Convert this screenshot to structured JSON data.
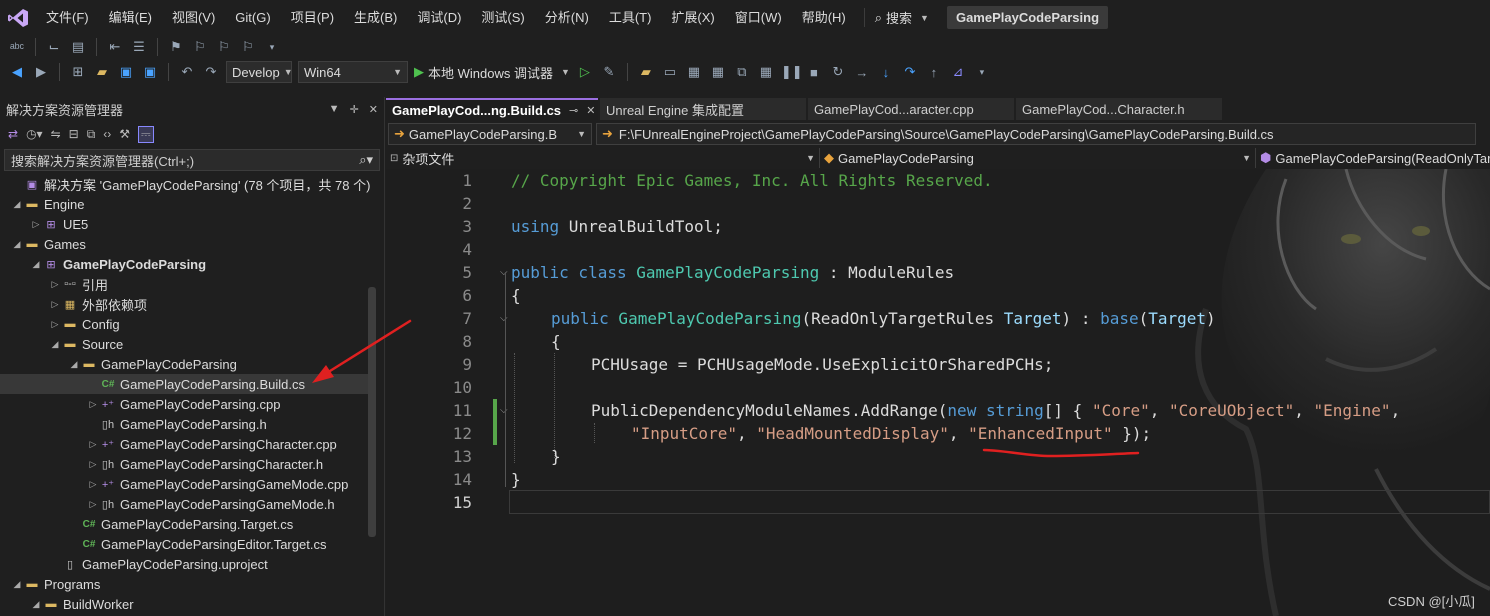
{
  "menu": {
    "items": [
      "文件(F)",
      "编辑(E)",
      "视图(V)",
      "Git(G)",
      "项目(P)",
      "生成(B)",
      "调试(D)",
      "测试(S)",
      "分析(N)",
      "工具(T)",
      "扩展(X)",
      "窗口(W)",
      "帮助(H)"
    ],
    "search_label": "搜索",
    "project_title": "GamePlayCodeParsing"
  },
  "toolbar": {
    "config_value": "Develop",
    "platform_value": "Win64",
    "debugger_label": "本地 Windows 调试器"
  },
  "solution_explorer": {
    "title": "解决方案资源管理器",
    "search_placeholder": "搜索解决方案资源管理器(Ctrl+;)",
    "tree": [
      {
        "label": "解决方案 'GamePlayCodeParsing' (78 个项目，共 78 个)",
        "icon": "solution-icon",
        "depth": 0,
        "expander": ""
      },
      {
        "label": "Engine",
        "icon": "folder-icon",
        "depth": 0,
        "expander": "open"
      },
      {
        "label": "UE5",
        "icon": "project-icon",
        "depth": 1,
        "expander": "closed"
      },
      {
        "label": "Games",
        "icon": "folder-icon",
        "depth": 0,
        "expander": "open"
      },
      {
        "label": "GamePlayCodeParsing",
        "icon": "project-icon",
        "depth": 1,
        "expander": "open",
        "bold": true
      },
      {
        "label": "引用",
        "icon": "references-icon",
        "depth": 2,
        "expander": "closed"
      },
      {
        "label": "外部依赖项",
        "icon": "external-deps-icon",
        "depth": 2,
        "expander": "closed"
      },
      {
        "label": "Config",
        "icon": "folder-icon",
        "depth": 2,
        "expander": "closed"
      },
      {
        "label": "Source",
        "icon": "folder-icon",
        "depth": 2,
        "expander": "open"
      },
      {
        "label": "GamePlayCodeParsing",
        "icon": "folder-icon",
        "depth": 3,
        "expander": "open"
      },
      {
        "label": "GamePlayCodeParsing.Build.cs",
        "icon": "csharp-file-icon",
        "depth": 4,
        "expander": "",
        "selected": true
      },
      {
        "label": "GamePlayCodeParsing.cpp",
        "icon": "cpp-file-icon",
        "depth": 4,
        "expander": "closed"
      },
      {
        "label": "GamePlayCodeParsing.h",
        "icon": "header-file-icon",
        "depth": 4,
        "expander": ""
      },
      {
        "label": "GamePlayCodeParsingCharacter.cpp",
        "icon": "cpp-file-icon",
        "depth": 4,
        "expander": "closed"
      },
      {
        "label": "GamePlayCodeParsingCharacter.h",
        "icon": "header-file-icon",
        "depth": 4,
        "expander": "closed"
      },
      {
        "label": "GamePlayCodeParsingGameMode.cpp",
        "icon": "cpp-file-icon",
        "depth": 4,
        "expander": "closed"
      },
      {
        "label": "GamePlayCodeParsingGameMode.h",
        "icon": "header-file-icon",
        "depth": 4,
        "expander": "closed"
      },
      {
        "label": "GamePlayCodeParsing.Target.cs",
        "icon": "csharp-file-icon",
        "depth": 3,
        "expander": ""
      },
      {
        "label": "GamePlayCodeParsingEditor.Target.cs",
        "icon": "csharp-file-icon",
        "depth": 3,
        "expander": ""
      },
      {
        "label": "GamePlayCodeParsing.uproject",
        "icon": "file-icon",
        "depth": 2,
        "expander": ""
      },
      {
        "label": "Programs",
        "icon": "folder-icon",
        "depth": 0,
        "expander": "open"
      },
      {
        "label": "BuildWorker",
        "icon": "folder-icon",
        "depth": 1,
        "expander": "open"
      }
    ]
  },
  "tabs": [
    {
      "label": "GamePlayCod...ng.Build.cs",
      "active": true
    },
    {
      "label": "Unreal Engine 集成配置",
      "active": false
    },
    {
      "label": "GamePlayCod...aracter.cpp",
      "active": false
    },
    {
      "label": "GamePlayCod...Character.h",
      "active": false
    }
  ],
  "pathbar": {
    "file_combo": "GamePlayCodeParsing.B",
    "full_path": "F:\\FUnrealEngineProject\\GamePlayCodeParsing\\Source\\GamePlayCodeParsing\\GamePlayCodeParsing.Build.cs"
  },
  "navbar": {
    "scope": "杂项文件",
    "type": "GamePlayCodeParsing",
    "member": "GamePlayCodeParsing(ReadOnlyTarg"
  },
  "editor": {
    "line_numbers": [
      "1",
      "2",
      "3",
      "4",
      "5",
      "6",
      "7",
      "8",
      "9",
      "10",
      "11",
      "12",
      "13",
      "14",
      "15"
    ],
    "code": {
      "l1": "// Copyright Epic Games, Inc. All Rights Reserved.",
      "l3_kw": "using",
      "l3_rest": " UnrealBuildTool;",
      "l5_kw1": "public",
      "l5_kw2": " class ",
      "l5_ty": "GamePlayCodeParsing",
      "l5_rest1": " : ",
      "l5_rest2": "ModuleRules",
      "l6": "{",
      "l7_kw": "public",
      "l7_fn": " GamePlayCodeParsing",
      "l7_p1": "(ReadOnlyTargetRules ",
      "l7_id": "Target",
      "l7_p2": ") : ",
      "l7_base": "base",
      "l7_p3": "(",
      "l7_id2": "Target",
      "l7_p4": ")",
      "l8": "{",
      "l9": "PCHUsage = PCHUsageMode.UseExplicitOrSharedPCHs;",
      "l11_a": "PublicDependencyModuleNames.AddRange(",
      "l11_new": "new",
      "l11_string": " string",
      "l11_b": "[] { ",
      "l11_s1": "\"Core\"",
      "l11_c1": ", ",
      "l11_s2": "\"CoreUObject\"",
      "l11_c2": ", ",
      "l11_s3": "\"Engine\"",
      "l11_c3": ",",
      "l12_s1": "\"InputCore\"",
      "l12_c1": ", ",
      "l12_s2": "\"HeadMountedDisplay\"",
      "l12_c2": ", ",
      "l12_s3": "\"EnhancedInput\"",
      "l12_end": " });",
      "l13": "}",
      "l14": "}"
    }
  },
  "watermark": "CSDN @[小瓜]",
  "colors": {
    "accent": "#9b6fe0",
    "keyword": "#569cd6",
    "type": "#4ec9b0",
    "string": "#d69d85",
    "comment": "#57a64a",
    "annotation": "#e02020"
  }
}
